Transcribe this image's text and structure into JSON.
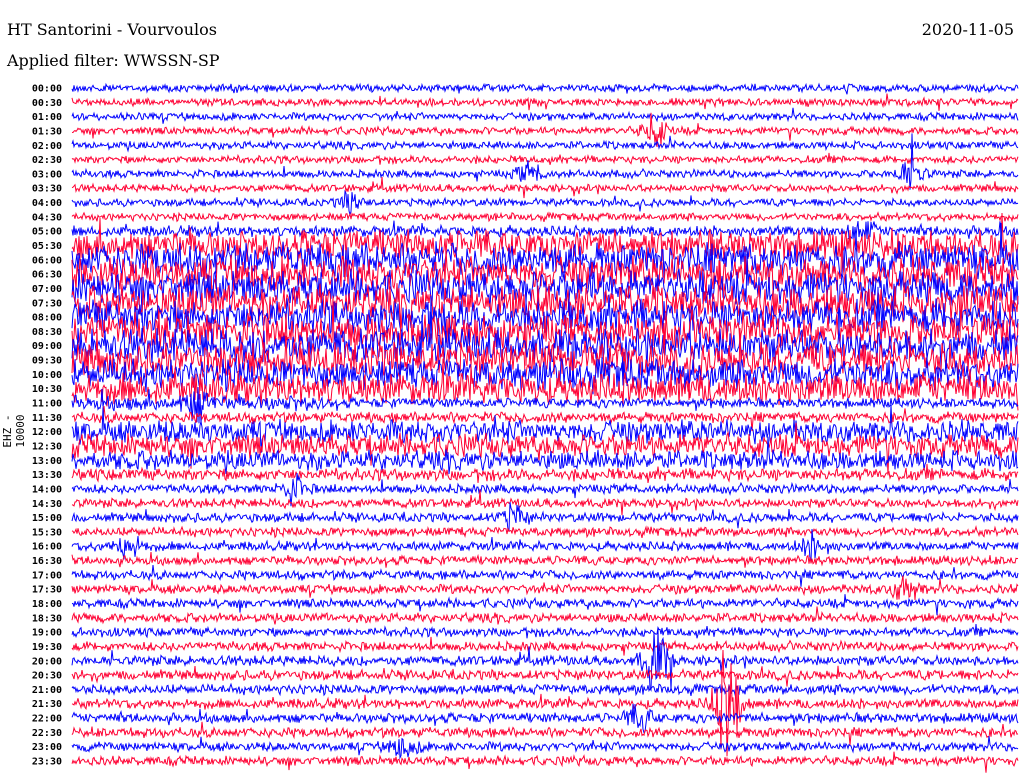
{
  "header": {
    "title": "HT Santorini - Vourvoulos",
    "filter": "Applied filter: WWSSN-SP",
    "date": "2020-11-05"
  },
  "chart_data": {
    "type": "line",
    "title": "HT Santorini - Vourvoulos",
    "subtitle": "Applied filter: WWSSN-SP",
    "ylabel": "EHZ - 10000",
    "row_minutes": 30,
    "colors": [
      "#0000ff",
      "#ff0033"
    ],
    "rows": [
      "00:00",
      "00:30",
      "01:00",
      "01:30",
      "02:00",
      "02:30",
      "03:00",
      "03:30",
      "04:00",
      "04:30",
      "05:00",
      "05:30",
      "06:00",
      "06:30",
      "07:00",
      "07:30",
      "08:00",
      "08:30",
      "09:00",
      "09:30",
      "10:00",
      "10:30",
      "11:00",
      "11:30",
      "12:00",
      "12:30",
      "13:00",
      "13:30",
      "14:00",
      "14:30",
      "15:00",
      "15:30",
      "16:00",
      "16:30",
      "17:00",
      "17:30",
      "18:00",
      "18:30",
      "19:00",
      "19:30",
      "20:00",
      "20:30",
      "21:00",
      "21:30",
      "22:00",
      "22:30",
      "23:00",
      "23:30"
    ],
    "relative_amplitude": [
      1,
      1,
      1,
      1,
      1,
      1,
      1,
      1,
      1,
      1,
      1.4,
      4,
      4.5,
      4.5,
      4.5,
      4.5,
      4.5,
      4.5,
      4.5,
      4.5,
      4,
      4,
      2,
      1.4,
      3,
      3,
      2.5,
      1.6,
      1.2,
      1.2,
      1.2,
      1.2,
      1.2,
      1.2,
      1.2,
      1.2,
      1.2,
      1.2,
      1.2,
      1.2,
      1.3,
      1.3,
      1.3,
      1.3,
      1.3,
      1.3,
      1.2,
      1.2
    ],
    "events": [
      {
        "row": "01:30",
        "minute": 18.5,
        "amplitude": 4
      },
      {
        "row": "03:00",
        "minute": 14.5,
        "amplitude": 2.5
      },
      {
        "row": "03:00",
        "minute": 26.6,
        "amplitude": 4
      },
      {
        "row": "04:00",
        "minute": 8.9,
        "amplitude": 2.5
      },
      {
        "row": "05:00",
        "minute": 25,
        "amplitude": 3
      },
      {
        "row": "11:00",
        "minute": 4,
        "amplitude": 4
      },
      {
        "row": "14:00",
        "minute": 7,
        "amplitude": 3
      },
      {
        "row": "15:00",
        "minute": 14,
        "amplitude": 3
      },
      {
        "row": "16:00",
        "minute": 1.8,
        "amplitude": 3
      },
      {
        "row": "16:00",
        "minute": 23.5,
        "amplitude": 3
      },
      {
        "row": "17:30",
        "minute": 26.4,
        "amplitude": 3
      },
      {
        "row": "20:00",
        "minute": 18.5,
        "amplitude": 8
      },
      {
        "row": "21:30",
        "minute": 20.8,
        "amplitude": 14
      },
      {
        "row": "22:00",
        "minute": 18,
        "amplitude": 3
      },
      {
        "row": "23:00",
        "minute": 10.5,
        "amplitude": 3
      }
    ]
  }
}
